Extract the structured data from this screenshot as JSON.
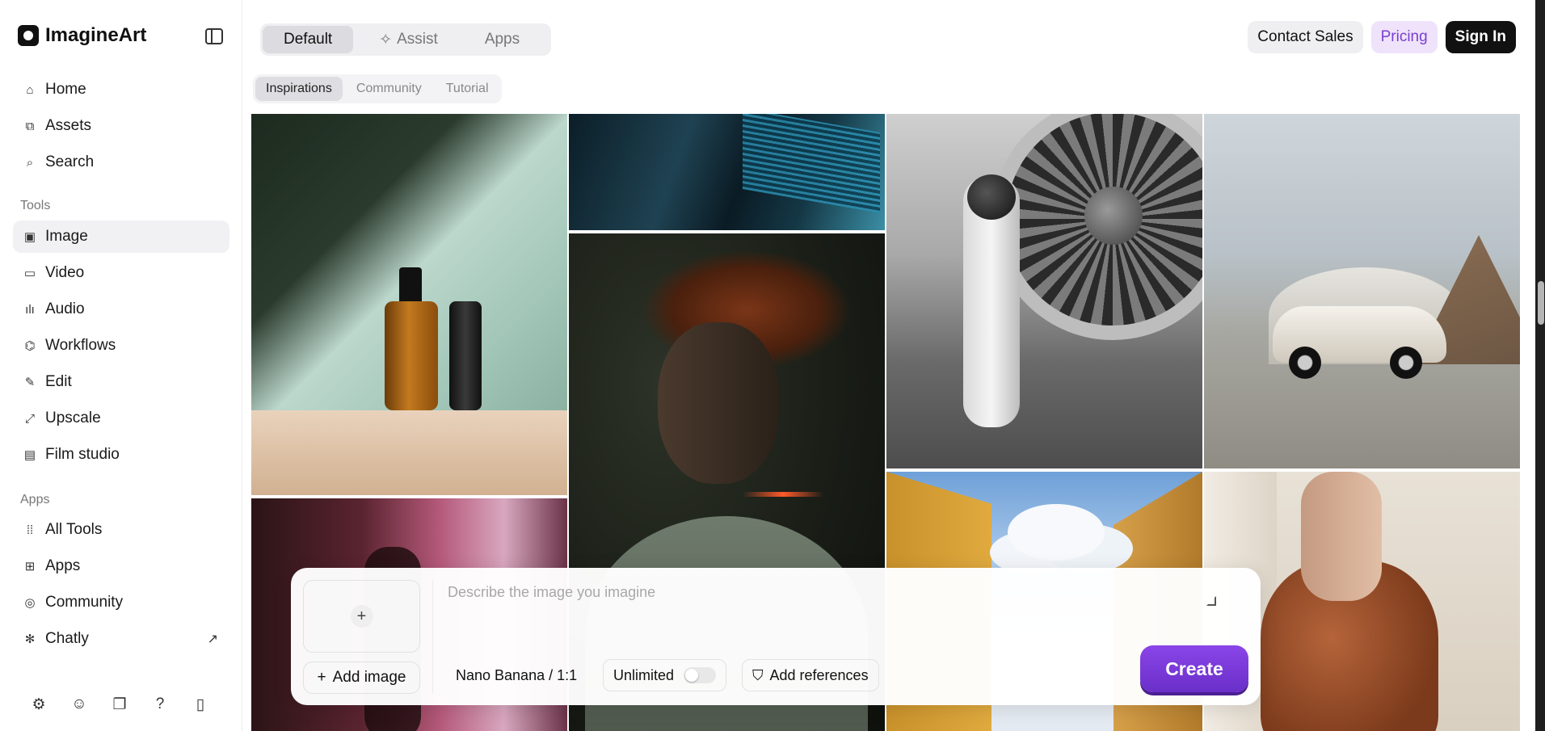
{
  "brand": {
    "name": "ImagineArt"
  },
  "sidebar": {
    "main_items": [
      {
        "label": "Home",
        "icon": "home-icon",
        "glyph": "⌂"
      },
      {
        "label": "Assets",
        "icon": "assets-icon",
        "glyph": "⧉"
      },
      {
        "label": "Search",
        "icon": "search-icon",
        "glyph": "⌕"
      }
    ],
    "tools_label": "Tools",
    "tools": [
      {
        "label": "Image",
        "icon": "image-icon",
        "glyph": "▣",
        "active": true
      },
      {
        "label": "Video",
        "icon": "video-icon",
        "glyph": "▭"
      },
      {
        "label": "Audio",
        "icon": "audio-icon",
        "glyph": "ılı"
      },
      {
        "label": "Workflows",
        "icon": "workflows-icon",
        "glyph": "⌬"
      },
      {
        "label": "Edit",
        "icon": "edit-icon",
        "glyph": "✎"
      },
      {
        "label": "Upscale",
        "icon": "upscale-icon",
        "glyph": "⤢"
      },
      {
        "label": "Film studio",
        "icon": "film-studio-icon",
        "glyph": "▤"
      }
    ],
    "apps_label": "Apps",
    "apps": [
      {
        "label": "All Tools",
        "icon": "all-tools-icon",
        "glyph": "⁞⁞"
      },
      {
        "label": "Apps",
        "icon": "apps-icon",
        "glyph": "⊞"
      },
      {
        "label": "Community",
        "icon": "community-icon",
        "glyph": "◎"
      },
      {
        "label": "Chatly",
        "icon": "chatly-icon",
        "glyph": "✻",
        "external": "↗"
      }
    ],
    "footer_icons": [
      {
        "icon": "settings-icon",
        "glyph": "⚙"
      },
      {
        "icon": "discord-icon",
        "glyph": "☺"
      },
      {
        "icon": "docs-icon",
        "glyph": "❐"
      },
      {
        "icon": "help-icon",
        "glyph": "?"
      },
      {
        "icon": "mobile-icon",
        "glyph": "▯"
      }
    ]
  },
  "header": {
    "mode_tabs": [
      {
        "label": "Default",
        "active": true
      },
      {
        "label": "Assist",
        "icon": "sparkle-icon",
        "glyph": "✧"
      },
      {
        "label": "Apps"
      }
    ],
    "sub_tabs": [
      {
        "label": "Inspirations",
        "active": true
      },
      {
        "label": "Community"
      },
      {
        "label": "Tutorial"
      }
    ],
    "actions": {
      "contact_sales": "Contact Sales",
      "pricing": "Pricing",
      "sign_in": "Sign In"
    }
  },
  "prompt": {
    "placeholder": "Describe the image you imagine",
    "add_image_label": "Add image",
    "model_label": "Nano Banana / 1:1",
    "unlimited_label": "Unlimited",
    "unlimited_on": false,
    "add_references_label": "Add references",
    "create_label": "Create"
  },
  "colors": {
    "accent": "#7a3fd0",
    "create_button": "#8a45e8",
    "pricing_bg": "#efe3fb",
    "sign_in_bg": "#111111"
  }
}
